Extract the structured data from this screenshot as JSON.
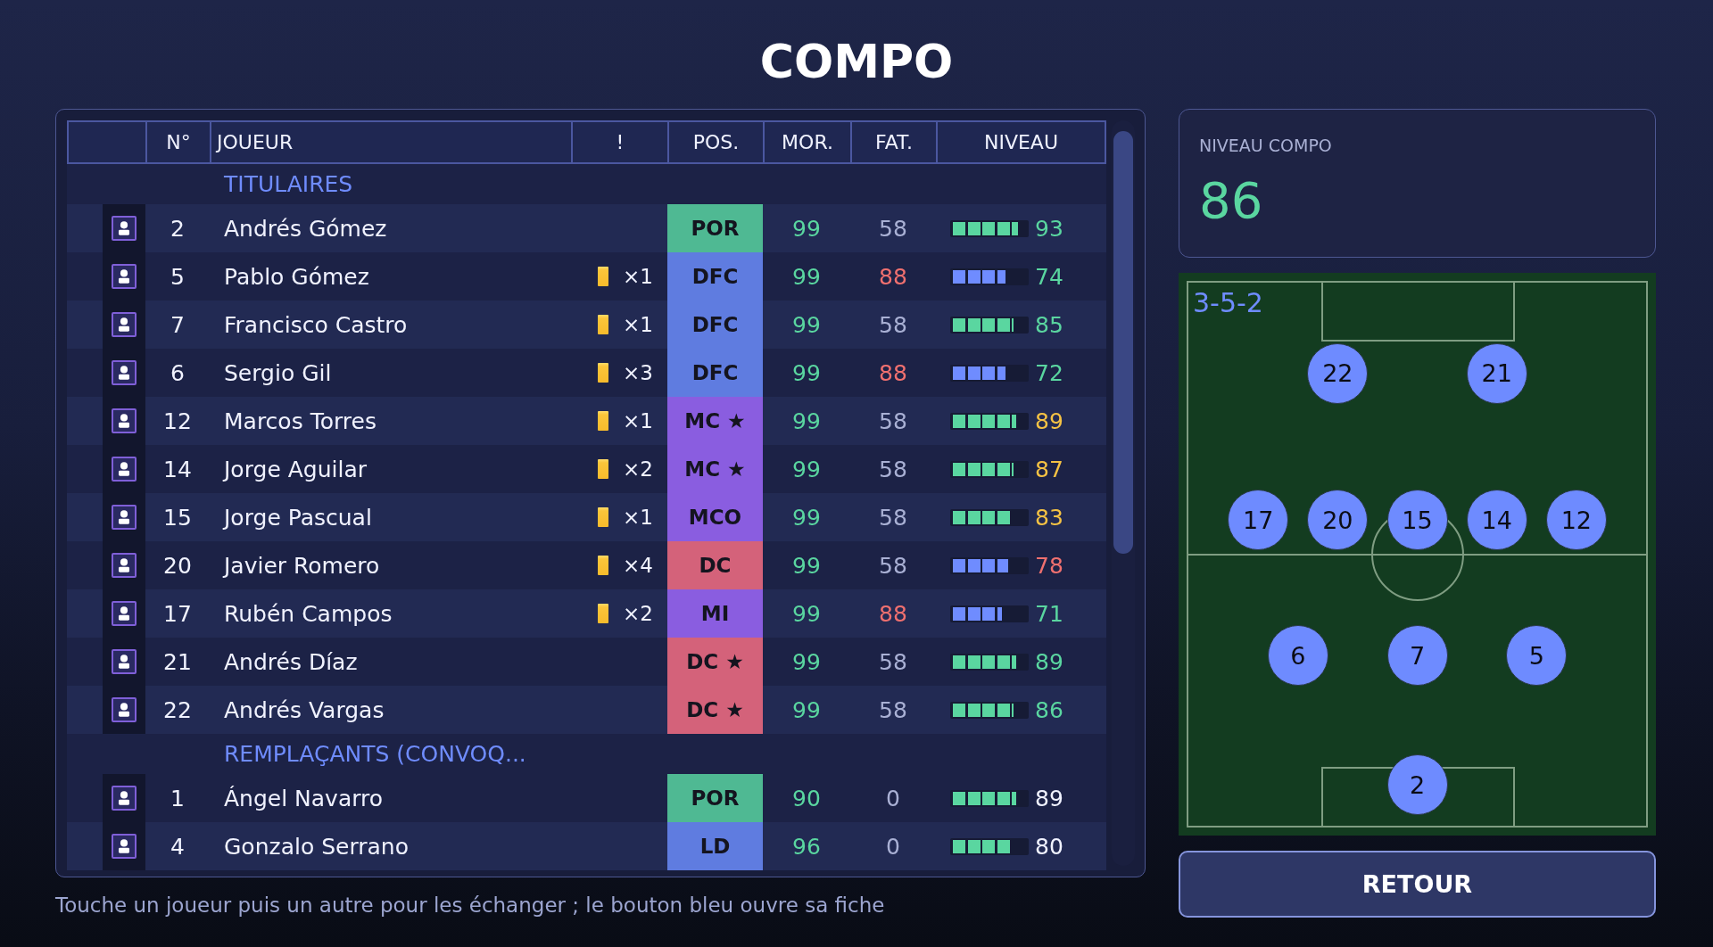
{
  "title": "COMPO",
  "table": {
    "columns": [
      "N°",
      "JOUEUR",
      "!",
      "POS.",
      "MOR.",
      "FAT.",
      "NIVEAU"
    ],
    "sections": [
      {
        "title": "TITULAIRES",
        "rows": [
          {
            "number": "2",
            "name": "Andrés Gómez",
            "position": {
              "text": "POR",
              "color": "#4fb993"
            },
            "morale": {
              "text": "99",
              "color": "#5ad6a0"
            },
            "fatigue": {
              "text": "58",
              "color": "#a9b0d4"
            },
            "rating": {
              "level": 0.895,
              "color": "#5ad6a0"
            },
            "rating_value": {
              "text": "93",
              "color": "#5ad6a0"
            }
          },
          {
            "number": "5",
            "name": "Pablo Gómez",
            "cards": "×1",
            "position": {
              "text": "DFC",
              "color": "#5f7ce0"
            },
            "morale": {
              "text": "99",
              "color": "#5ad6a0"
            },
            "fatigue": {
              "text": "88",
              "color": "#f0706f"
            },
            "rating": {
              "level": 0.724,
              "color": "#6f8cff"
            },
            "rating_value": {
              "text": "74",
              "color": "#5ad6a0"
            }
          },
          {
            "number": "7",
            "name": "Francisco Castro",
            "cards": "×1",
            "position": {
              "text": "DFC",
              "color": "#5f7ce0"
            },
            "morale": {
              "text": "99",
              "color": "#5ad6a0"
            },
            "fatigue": {
              "text": "58",
              "color": "#a9b0d4"
            },
            "rating": {
              "level": 0.824,
              "color": "#5ad6a0"
            },
            "rating_value": {
              "text": "85",
              "color": "#5ad6a0"
            }
          },
          {
            "number": "6",
            "name": "Sergio Gil",
            "cards": "×3",
            "position": {
              "text": "DFC",
              "color": "#5f7ce0"
            },
            "morale": {
              "text": "99",
              "color": "#5ad6a0"
            },
            "fatigue": {
              "text": "88",
              "color": "#f0706f"
            },
            "rating": {
              "level": 0.724,
              "color": "#6f8cff"
            },
            "rating_value": {
              "text": "72",
              "color": "#5ad6a0"
            }
          },
          {
            "number": "12",
            "name": "Marcos Torres",
            "cards": "×1",
            "position": {
              "text": "MC ★",
              "color": "#8a5de0"
            },
            "morale": {
              "text": "99",
              "color": "#5ad6a0"
            },
            "fatigue": {
              "text": "58",
              "color": "#a9b0d4"
            },
            "rating": {
              "level": 0.867,
              "color": "#5ad6a0"
            },
            "rating_value": {
              "text": "89",
              "color": "#f5c244"
            }
          },
          {
            "number": "14",
            "name": "Jorge Aguilar",
            "cards": "×2",
            "position": {
              "text": "MC ★",
              "color": "#8a5de0"
            },
            "morale": {
              "text": "99",
              "color": "#5ad6a0"
            },
            "fatigue": {
              "text": "58",
              "color": "#a9b0d4"
            },
            "rating": {
              "level": 0.824,
              "color": "#5ad6a0"
            },
            "rating_value": {
              "text": "87",
              "color": "#f5c244"
            }
          },
          {
            "number": "15",
            "name": "Jorge Pascual",
            "cards": "×1",
            "position": {
              "text": "MCO",
              "color": "#8a5de0"
            },
            "morale": {
              "text": "99",
              "color": "#5ad6a0"
            },
            "fatigue": {
              "text": "58",
              "color": "#a9b0d4"
            },
            "rating": {
              "level": 0.78,
              "color": "#5ad6a0"
            },
            "rating_value": {
              "text": "83",
              "color": "#f5c244"
            }
          },
          {
            "number": "20",
            "name": "Javier Romero",
            "cards": "×4",
            "position": {
              "text": "DC",
              "color": "#d4627a"
            },
            "morale": {
              "text": "99",
              "color": "#5ad6a0"
            },
            "fatigue": {
              "text": "58",
              "color": "#a9b0d4"
            },
            "rating": {
              "level": 0.75,
              "color": "#6f8cff"
            },
            "rating_value": {
              "text": "78",
              "color": "#f0706f"
            }
          },
          {
            "number": "17",
            "name": "Rubén Campos",
            "cards": "×2",
            "position": {
              "text": "MI",
              "color": "#8a5de0"
            },
            "morale": {
              "text": "99",
              "color": "#5ad6a0"
            },
            "fatigue": {
              "text": "88",
              "color": "#f0706f"
            },
            "rating": {
              "level": 0.676,
              "color": "#6f8cff"
            },
            "rating_value": {
              "text": "71",
              "color": "#5ad6a0"
            }
          },
          {
            "number": "21",
            "name": "Andrés Díaz",
            "position": {
              "text": "DC ★",
              "color": "#d4627a"
            },
            "morale": {
              "text": "99",
              "color": "#5ad6a0"
            },
            "fatigue": {
              "text": "58",
              "color": "#a9b0d4"
            },
            "rating": {
              "level": 0.867,
              "color": "#5ad6a0"
            },
            "rating_value": {
              "text": "89",
              "color": "#5ad6a0"
            }
          },
          {
            "number": "22",
            "name": "Andrés Vargas",
            "position": {
              "text": "DC ★",
              "color": "#d4627a"
            },
            "morale": {
              "text": "99",
              "color": "#5ad6a0"
            },
            "fatigue": {
              "text": "58",
              "color": "#a9b0d4"
            },
            "rating": {
              "level": 0.824,
              "color": "#5ad6a0"
            },
            "rating_value": {
              "text": "86",
              "color": "#5ad6a0"
            }
          }
        ]
      },
      {
        "title": "REMPLAÇANTS (CONVOQ...",
        "rows": [
          {
            "number": "1",
            "name": "Ángel Navarro",
            "position": {
              "text": "POR",
              "color": "#4fb993"
            },
            "morale": {
              "text": "90",
              "color": "#5ad6a0"
            },
            "fatigue": {
              "text": "0",
              "color": "#a9b0d4"
            },
            "rating": {
              "level": 0.867,
              "color": "#5ad6a0"
            },
            "rating_value": {
              "text": "89",
              "color": "#f0f2ff"
            }
          },
          {
            "number": "4",
            "name": "Gonzalo Serrano",
            "position": {
              "text": "LD",
              "color": "#5f7ce0"
            },
            "morale": {
              "text": "96",
              "color": "#5ad6a0"
            },
            "fatigue": {
              "text": "0",
              "color": "#a9b0d4"
            },
            "rating": {
              "level": 0.78,
              "color": "#5ad6a0"
            },
            "rating_value": {
              "text": "80",
              "color": "#f0f2ff"
            }
          }
        ]
      }
    ]
  },
  "hint": "Touche un joueur puis un autre pour les échanger ; le bouton bleu ouvre sa fiche",
  "summary": {
    "label": "NIVEAU COMPO",
    "value": "86"
  },
  "pitch": {
    "formation": "3-5-2",
    "lines": [
      {
        "players": [
          "22",
          "21"
        ]
      },
      {
        "players": [
          "17",
          "20",
          "15",
          "14",
          "12"
        ]
      },
      {
        "players": [
          "6",
          "7",
          "5"
        ]
      },
      {
        "players": [
          "2"
        ]
      }
    ]
  },
  "buttons": [
    {
      "label": "RETOUR"
    }
  ]
}
